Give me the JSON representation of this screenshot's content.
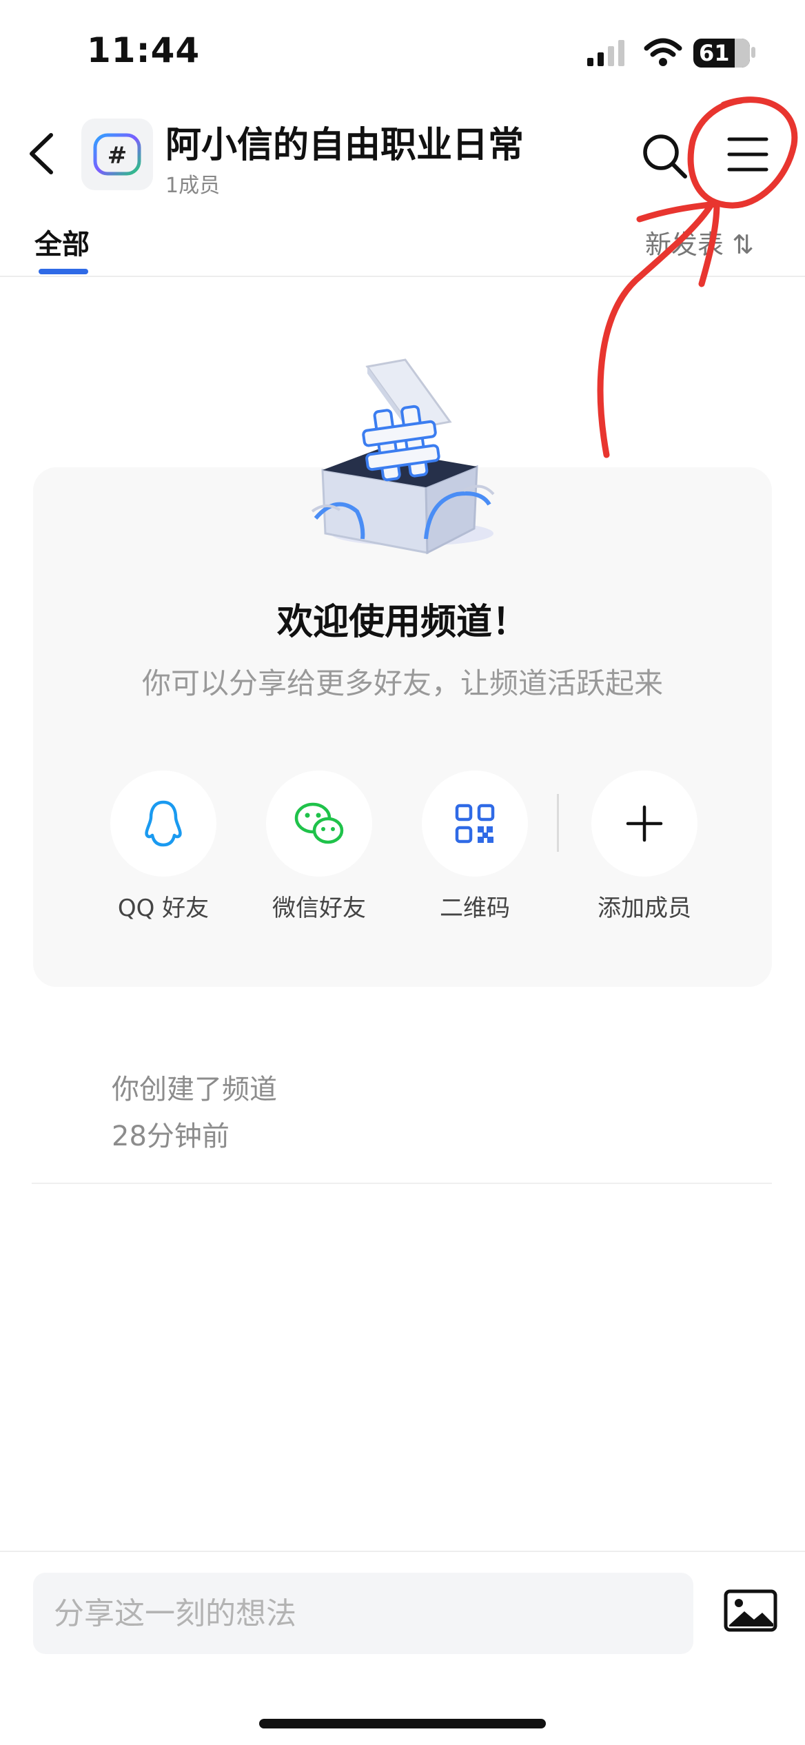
{
  "status_bar": {
    "time": "11:44",
    "battery": "61"
  },
  "header": {
    "channel_name": "阿小信的自由职业日常",
    "member_count": "1成员",
    "avatar_icon": "hashtag-icon"
  },
  "tabs": {
    "all_label": "全部",
    "sort_label": "新发表 ⇅",
    "accent_color": "#2f6ae6"
  },
  "welcome": {
    "title": "欢迎使用频道！",
    "subtitle": "你可以分享给更多好友，让频道活跃起来",
    "share_options": [
      {
        "label": "QQ 好友",
        "icon": "qq-penguin-icon"
      },
      {
        "label": "微信好友",
        "icon": "wechat-icon"
      },
      {
        "label": "二维码",
        "icon": "qr-code-icon"
      },
      {
        "label": "添加成员",
        "icon": "plus-icon"
      }
    ]
  },
  "activity": {
    "text": "你创建了频道",
    "time": "28分钟前"
  },
  "composer": {
    "placeholder": "分享这一刻的想法"
  },
  "colors": {
    "annotation_red": "#e8352f",
    "wechat_green": "#1fc24a",
    "qq_blue": "#1a9af0",
    "qr_blue": "#2f6ae6"
  }
}
